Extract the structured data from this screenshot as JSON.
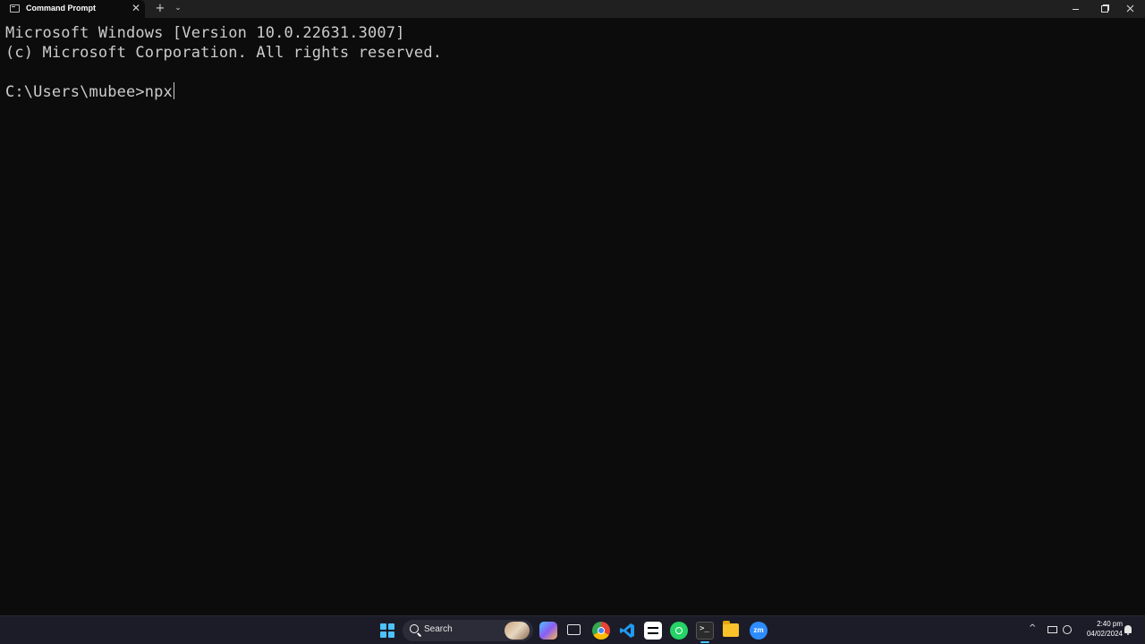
{
  "window": {
    "tab_title": "Command Prompt",
    "tab_close": "✕",
    "new_tab": "+",
    "tab_dropdown": "⌄"
  },
  "terminal": {
    "lines": [
      "Microsoft Windows [Version 10.0.22631.3007]",
      "(c) Microsoft Corporation. All rights reserved.",
      "",
      "C:\\Users\\mubee>npx"
    ]
  },
  "taskbar": {
    "search_label": "Search",
    "zoom_text": "zm",
    "clock_time": "2:40 pm",
    "clock_date": "04/02/2024",
    "tray_chevron": "^",
    "accent_color": "#4cc2ff",
    "apps": [
      "start-icon",
      "copilot-icon",
      "task-view-icon",
      "chrome-icon",
      "vscode-icon",
      "capcut-icon",
      "whatsapp-icon",
      "terminal-icon",
      "file-explorer-icon",
      "zoom-icon"
    ]
  }
}
